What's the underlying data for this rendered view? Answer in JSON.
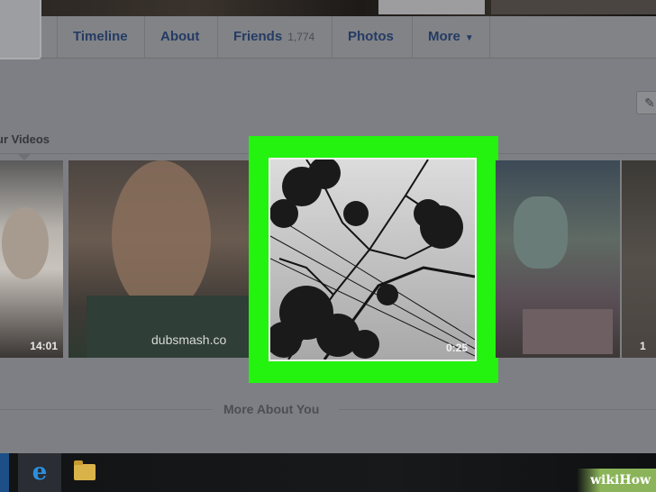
{
  "nav": {
    "items": [
      {
        "label": "Timeline"
      },
      {
        "label": "About"
      },
      {
        "label": "Friends",
        "count": "1,774"
      },
      {
        "label": "Photos"
      },
      {
        "label": "More",
        "caret": "▼"
      }
    ],
    "edit_icon": "pencil-icon"
  },
  "videos": {
    "section_title": "ur Videos",
    "items": [
      {
        "duration": "14:01"
      },
      {
        "duration": "",
        "overlay_text": "dubsmash.co"
      },
      {
        "duration": "0:25",
        "highlighted": true
      },
      {
        "duration": ""
      },
      {
        "duration": "1"
      }
    ],
    "highlight_color": "#24f20f"
  },
  "more_about": {
    "title": "More About You"
  },
  "taskbar": {
    "icons": [
      "start-icon",
      "internet-explorer-icon",
      "file-explorer-icon"
    ],
    "ie_glyph": "e"
  },
  "watermark": {
    "text": "wikiHow"
  }
}
